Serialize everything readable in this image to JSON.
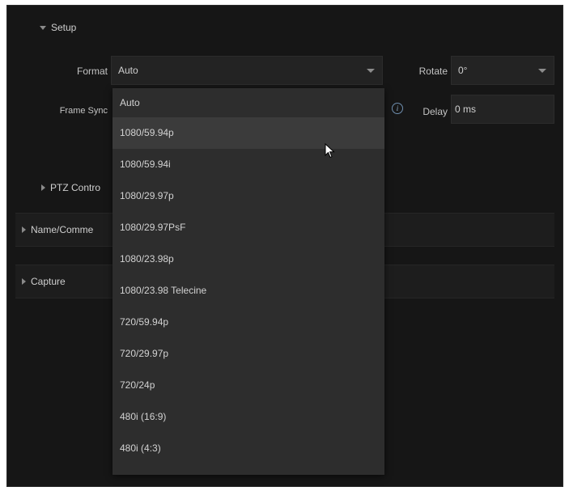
{
  "setup": {
    "title": "Setup"
  },
  "format": {
    "label": "Format",
    "value": "Auto"
  },
  "rotate": {
    "label": "Rotate",
    "value": "0°"
  },
  "frame_sync": {
    "label": "Frame Sync"
  },
  "delay": {
    "label": "Delay",
    "value": "0 ms"
  },
  "ptz": {
    "label": "PTZ Contro"
  },
  "name_comments": {
    "label": "Name/Comme"
  },
  "capture": {
    "label": "Capture"
  },
  "dropdown": {
    "hovered": "1080/59.94p",
    "options": [
      "Auto",
      "1080/59.94p",
      "1080/59.94i",
      "1080/29.97p",
      "1080/29.97PsF",
      "1080/23.98p",
      "1080/23.98 Telecine",
      "720/59.94p",
      "720/29.97p",
      "720/24p",
      "480i (16:9)",
      "480i (4:3)"
    ]
  },
  "colors": {
    "background": "#161616",
    "dropdown": "#2d2d2d",
    "hover": "#3b3b3b",
    "info_accent": "#6f8fb0"
  }
}
